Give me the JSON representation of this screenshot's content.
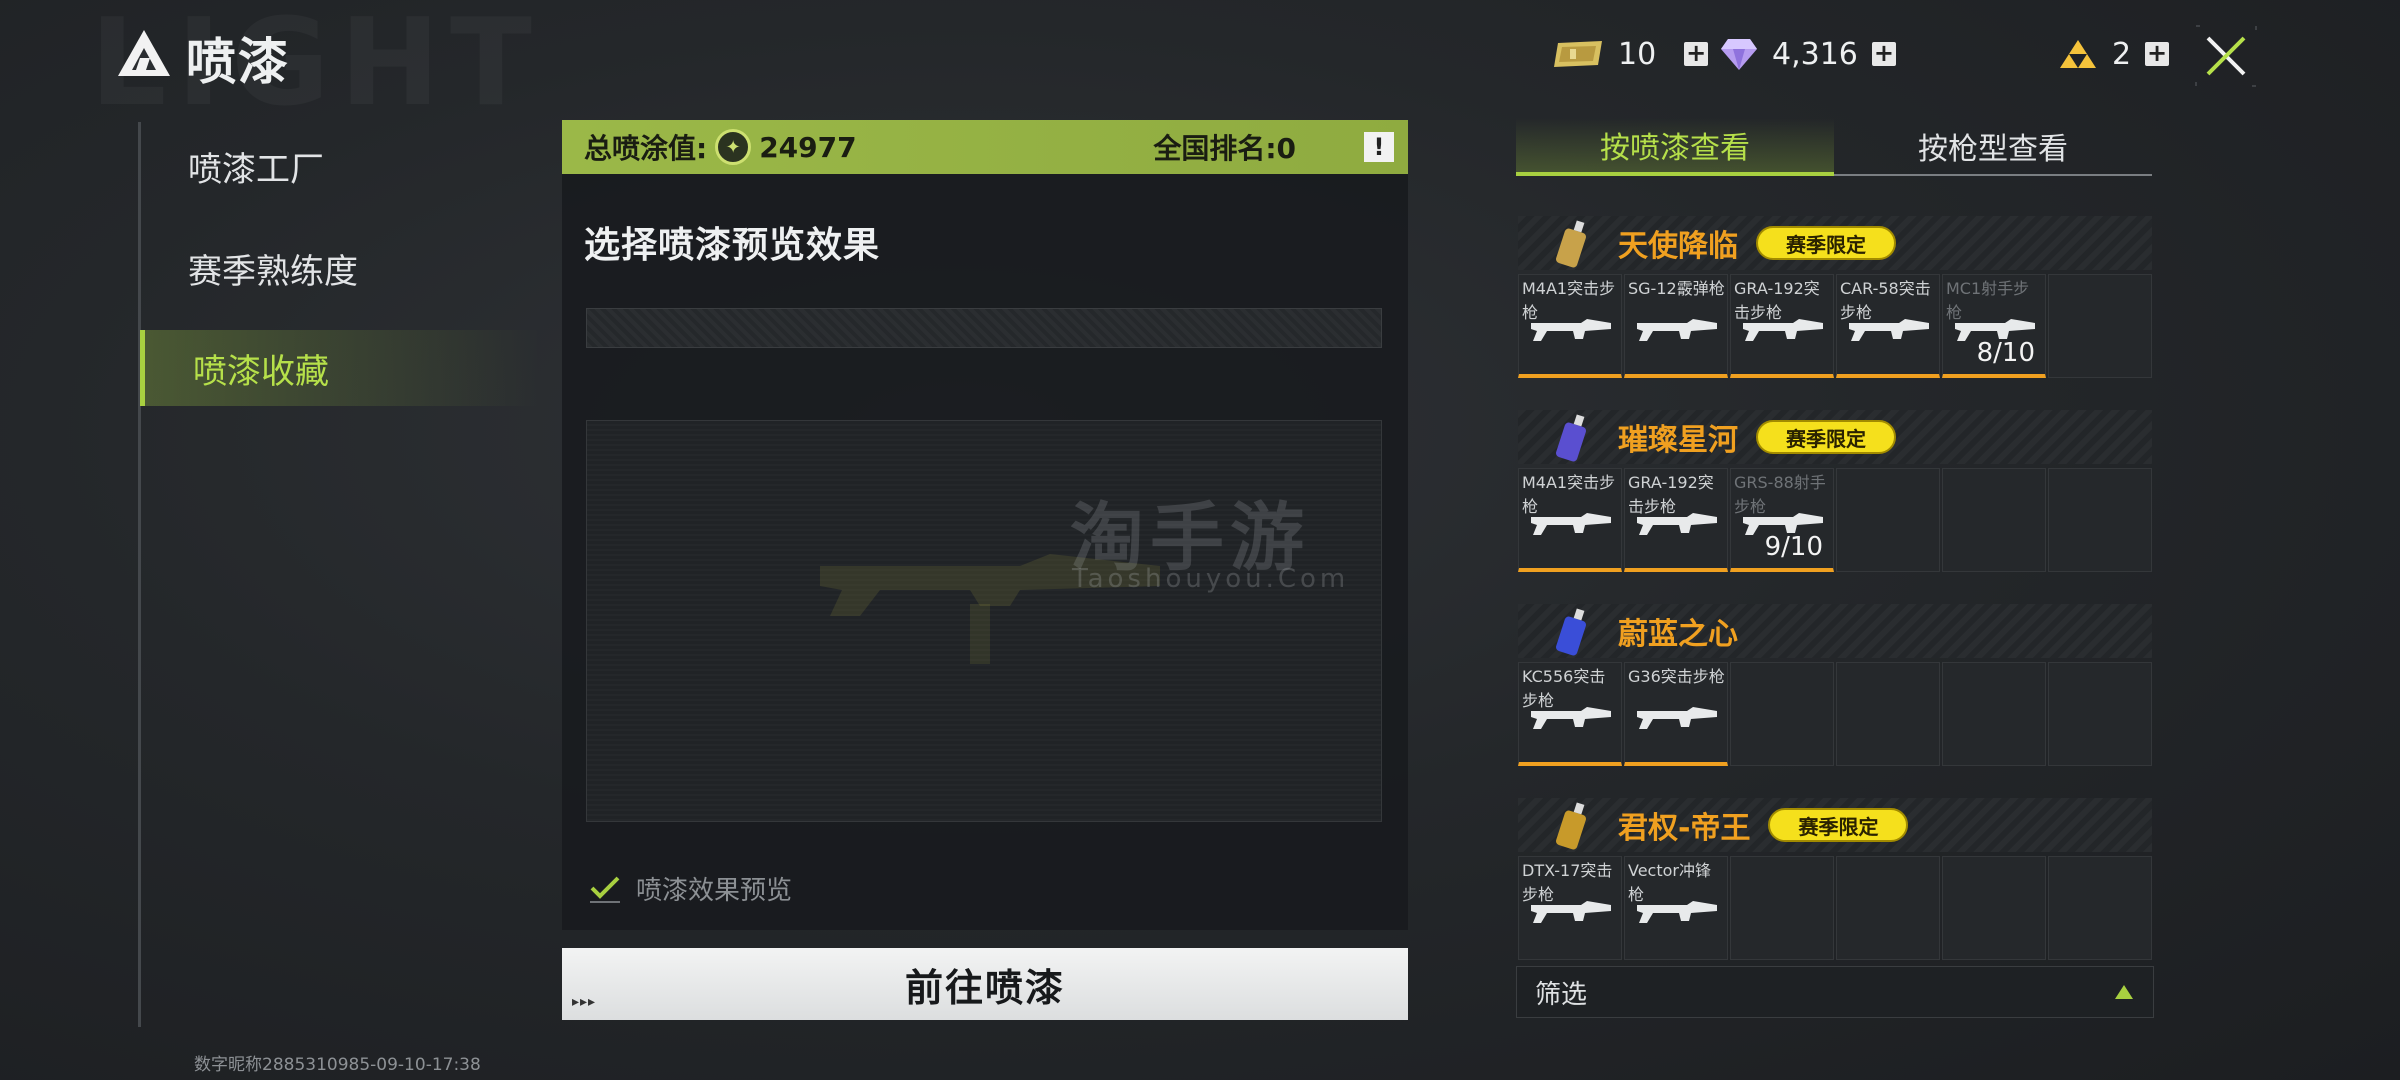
{
  "header": {
    "title": "喷漆",
    "bg_word": "LIGHT",
    "currencies": [
      {
        "icon": "ticket-icon",
        "value": "10"
      },
      {
        "icon": "diamond-icon",
        "value": "4,316"
      },
      {
        "icon": "triforce-icon",
        "value": "2"
      }
    ],
    "plus_label": "+"
  },
  "sidebar": {
    "items": [
      {
        "label": "喷漆工厂",
        "active": false
      },
      {
        "label": "赛季熟练度",
        "active": false
      },
      {
        "label": "喷漆收藏",
        "active": true
      }
    ],
    "footer": "数字昵称2885310985-09-10-17:38"
  },
  "center": {
    "total_label": "总喷涂值:",
    "total_value": "24977",
    "rank_label": "全国排名:0",
    "info_label": "!",
    "preview_title": "选择喷漆预览效果",
    "watermark": "淘手游",
    "watermark_sub": "Taoshouyou.Com",
    "checkbox_label": "喷漆效果预览",
    "checkbox_checked": true,
    "go_button": "前往喷漆",
    "go_deco": "▸▸▸"
  },
  "right": {
    "tabs": [
      {
        "label": "按喷漆查看",
        "active": true
      },
      {
        "label": "按枪型查看",
        "active": false
      }
    ],
    "groups": [
      {
        "name": "天使降临",
        "badge": "赛季限定",
        "can_color": "#c8a24a",
        "cells": [
          {
            "gun": "M4A1突击步枪",
            "owned": true
          },
          {
            "gun": "SG-12霰弹枪",
            "owned": true
          },
          {
            "gun": "GRA-192突击步枪",
            "owned": true
          },
          {
            "gun": "CAR-58突击步枪",
            "owned": true
          },
          {
            "gun": "MC1射手步枪",
            "owned": true,
            "dim": true,
            "progress": "8/10"
          },
          {
            "gun": "",
            "owned": false
          }
        ]
      },
      {
        "name": "璀璨星河",
        "badge": "赛季限定",
        "can_color": "#5a4fd0",
        "cells": [
          {
            "gun": "M4A1突击步枪",
            "owned": true
          },
          {
            "gun": "GRA-192突击步枪",
            "owned": true
          },
          {
            "gun": "GRS-88射手步枪",
            "owned": true,
            "dim": true,
            "progress": "9/10"
          },
          {
            "gun": "",
            "owned": false
          },
          {
            "gun": "",
            "owned": false
          },
          {
            "gun": "",
            "owned": false
          }
        ]
      },
      {
        "name": "蔚蓝之心",
        "badge": "",
        "can_color": "#3a4ed8",
        "cells": [
          {
            "gun": "KC556突击步枪",
            "owned": true
          },
          {
            "gun": "G36突击步枪",
            "owned": true
          },
          {
            "gun": "",
            "owned": false
          },
          {
            "gun": "",
            "owned": false
          },
          {
            "gun": "",
            "owned": false
          },
          {
            "gun": "",
            "owned": false
          }
        ]
      },
      {
        "name": "君权-帝王",
        "badge": "赛季限定",
        "can_color": "#c89a2a",
        "cells": [
          {
            "gun": "DTX-17突击步枪",
            "owned": false
          },
          {
            "gun": "Vector冲锋枪",
            "owned": false
          },
          {
            "gun": "",
            "owned": false
          },
          {
            "gun": "",
            "owned": false
          },
          {
            "gun": "",
            "owned": false
          },
          {
            "gun": "",
            "owned": false
          }
        ]
      }
    ],
    "filter_label": "筛选"
  }
}
